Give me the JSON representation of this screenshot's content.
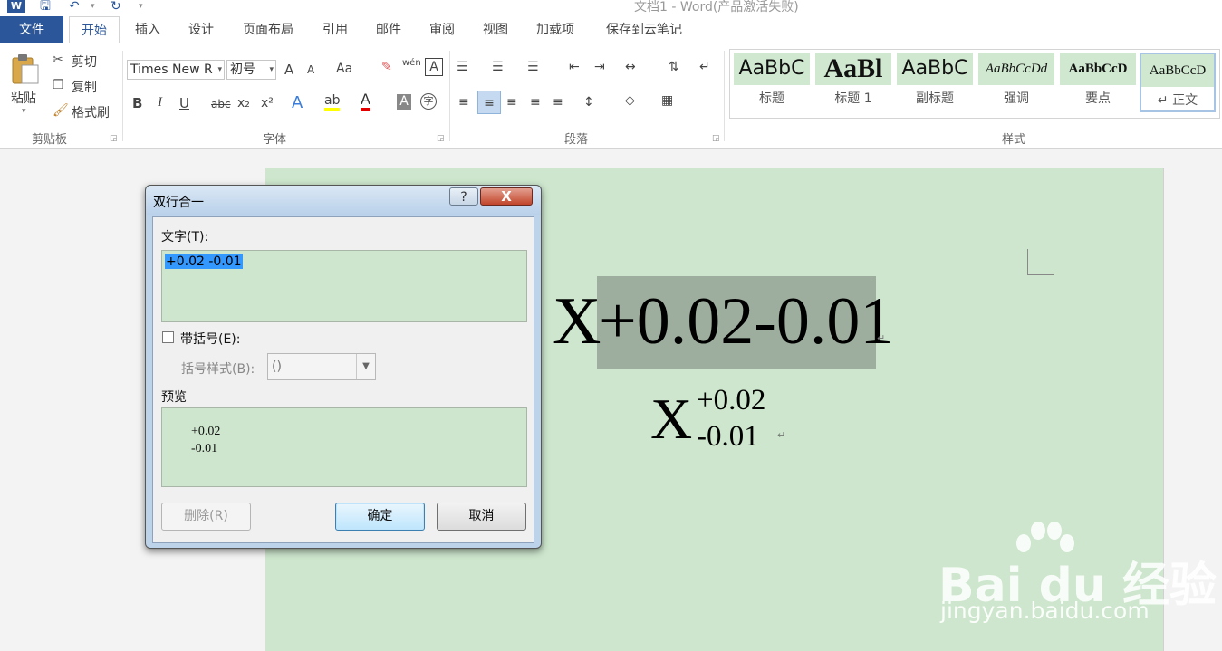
{
  "window": {
    "title": "文档1 - Word(产品激活失败)",
    "quick_access": {
      "word_logo": "W",
      "save_icon": "save-icon",
      "undo_icon": "undo-icon",
      "redo_icon": "redo-icon",
      "customize_icon": "chevron-down-icon"
    }
  },
  "tabs": [
    "文件",
    "开始",
    "插入",
    "设计",
    "页面布局",
    "引用",
    "邮件",
    "审阅",
    "视图",
    "加载项",
    "保存到云笔记"
  ],
  "active_tab": "开始",
  "ribbon": {
    "clipboard": {
      "paste": "粘贴",
      "cut": "剪切",
      "copy": "复制",
      "format_painter": "格式刷",
      "group_label": "剪贴板"
    },
    "font": {
      "font_name": "Times New R",
      "font_size": "初号",
      "grow": "A",
      "shrink": "A",
      "change_case": "Aa",
      "bold": "B",
      "italic": "I",
      "underline": "U",
      "strike": "abc",
      "subscript": "x₂",
      "superscript": "x²",
      "phonetic": "wén",
      "group_label": "字体"
    },
    "paragraph": {
      "group_label": "段落"
    },
    "styles": {
      "items": [
        {
          "sample": "AaBbC",
          "name": "标题"
        },
        {
          "sample": "AaBl",
          "name": "标题 1"
        },
        {
          "sample": "AaBbC",
          "name": "副标题"
        },
        {
          "sample": "AaBbCcDd",
          "name": "强调"
        },
        {
          "sample": "AaBbCcD",
          "name": "要点"
        },
        {
          "sample": "AaBbCcD",
          "name": "↵ 正文"
        }
      ],
      "group_label": "样式"
    }
  },
  "document": {
    "line1_x": "X",
    "line1_text": "+0.02-0.01",
    "line2_x": "X",
    "line2_upper": "+0.02",
    "line2_lower": "-0.01",
    "paragraph_mark": "↵"
  },
  "dialog": {
    "title": "双行合一",
    "help": "?",
    "close": "X",
    "text_label": "文字(T):",
    "text_value": "+0.02 -0.01",
    "bracket_checkbox_label": "带括号(E):",
    "bracket_checked": false,
    "bracket_style_label": "括号样式(B):",
    "bracket_style_value": "()",
    "preview_label": "预览",
    "preview_upper": "+0.02",
    "preview_lower": "-0.01",
    "delete_button": "删除(R)",
    "ok_button": "确定",
    "cancel_button": "取消"
  },
  "watermark": {
    "logo": "Bai  du 经验",
    "url": "jingyan.baidu.com"
  },
  "colors": {
    "accent": "#2b579a",
    "doc_bg": "#cde6cd",
    "highlight": "#9eae9e",
    "selection": "#3399ff"
  }
}
